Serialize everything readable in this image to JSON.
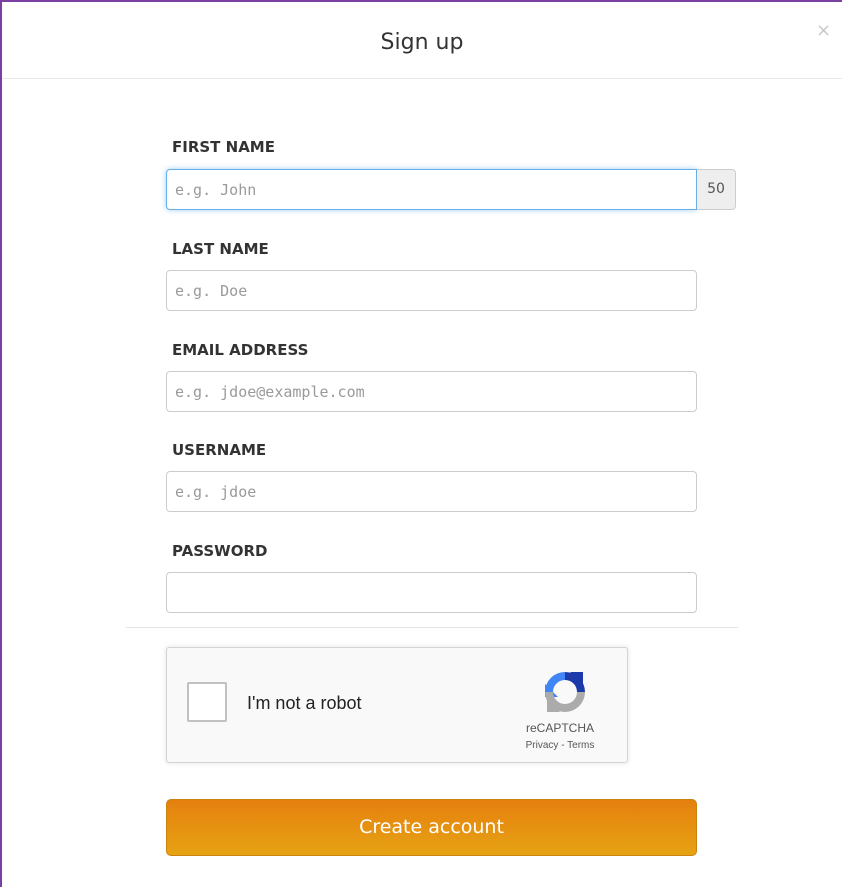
{
  "modal": {
    "title": "Sign up",
    "close_glyph": "×"
  },
  "form": {
    "first_name": {
      "label": "FIRST NAME",
      "placeholder": "e.g. John",
      "value": "",
      "char_limit": "50"
    },
    "last_name": {
      "label": "LAST NAME",
      "placeholder": "e.g. Doe",
      "value": ""
    },
    "email": {
      "label": "EMAIL ADDRESS",
      "placeholder": "e.g. jdoe@example.com",
      "value": ""
    },
    "username": {
      "label": "USERNAME",
      "placeholder": "e.g. jdoe",
      "value": ""
    },
    "password": {
      "label": "PASSWORD",
      "placeholder": "",
      "value": ""
    }
  },
  "captcha": {
    "label": "I'm not a robot",
    "brand": "reCAPTCHA",
    "privacy": "Privacy",
    "separator": " - ",
    "terms": "Terms",
    "checked": false
  },
  "submit": {
    "label": "Create account"
  },
  "colors": {
    "accent_border": "#7b3fa0",
    "button_top": "#e5800f",
    "button_bottom": "#e7a313",
    "focus": "#66afe9"
  },
  "icons": {
    "close": "close-icon",
    "recaptcha": "recaptcha-logo-icon"
  }
}
